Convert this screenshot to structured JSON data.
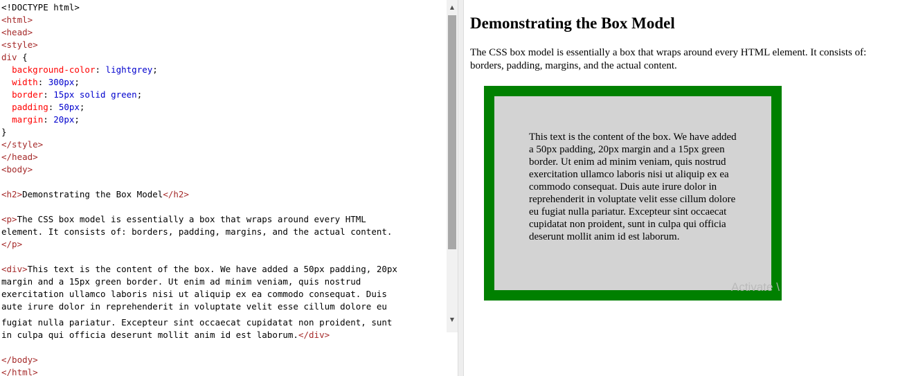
{
  "code_lines": [
    [
      {
        "t": "txt",
        "s": "<!DOCTYPE html>"
      }
    ],
    [
      {
        "t": "tag",
        "s": "<html>"
      }
    ],
    [
      {
        "t": "tag",
        "s": "<head>"
      }
    ],
    [
      {
        "t": "tag",
        "s": "<style>"
      }
    ],
    [
      {
        "t": "sel",
        "s": "div"
      },
      {
        "t": "pun",
        "s": " {"
      }
    ],
    [
      {
        "t": "pun",
        "s": "  "
      },
      {
        "t": "prop",
        "s": "background-color"
      },
      {
        "t": "pun",
        "s": ": "
      },
      {
        "t": "val",
        "s": "lightgrey"
      },
      {
        "t": "pun",
        "s": ";"
      }
    ],
    [
      {
        "t": "pun",
        "s": "  "
      },
      {
        "t": "prop",
        "s": "width"
      },
      {
        "t": "pun",
        "s": ": "
      },
      {
        "t": "val",
        "s": "300px"
      },
      {
        "t": "pun",
        "s": ";"
      }
    ],
    [
      {
        "t": "pun",
        "s": "  "
      },
      {
        "t": "prop",
        "s": "border"
      },
      {
        "t": "pun",
        "s": ": "
      },
      {
        "t": "val",
        "s": "15px solid green"
      },
      {
        "t": "pun",
        "s": ";"
      }
    ],
    [
      {
        "t": "pun",
        "s": "  "
      },
      {
        "t": "prop",
        "s": "padding"
      },
      {
        "t": "pun",
        "s": ": "
      },
      {
        "t": "val",
        "s": "50px"
      },
      {
        "t": "pun",
        "s": ";"
      }
    ],
    [
      {
        "t": "pun",
        "s": "  "
      },
      {
        "t": "prop",
        "s": "margin"
      },
      {
        "t": "pun",
        "s": ": "
      },
      {
        "t": "val",
        "s": "20px"
      },
      {
        "t": "pun",
        "s": ";"
      }
    ],
    [
      {
        "t": "pun",
        "s": "}"
      }
    ],
    [
      {
        "t": "tag",
        "s": "</style>"
      }
    ],
    [
      {
        "t": "tag",
        "s": "</head>"
      }
    ],
    [
      {
        "t": "tag",
        "s": "<body>"
      }
    ],
    [],
    [
      {
        "t": "tag",
        "s": "<h2>"
      },
      {
        "t": "txt",
        "s": "Demonstrating the Box Model"
      },
      {
        "t": "tag",
        "s": "</h2>"
      }
    ],
    [],
    [
      {
        "t": "tag",
        "s": "<p>"
      },
      {
        "t": "txt",
        "s": "The CSS box model is essentially a box that wraps around every HTML"
      }
    ],
    [
      {
        "t": "txt",
        "s": "element. It consists of: borders, padding, margins, and the actual content."
      }
    ],
    [
      {
        "t": "tag",
        "s": "</p>"
      }
    ],
    [],
    [
      {
        "t": "tag",
        "s": "<div>"
      },
      {
        "t": "txt",
        "s": "This text is the content of the box. We have added a 50px padding, 20px"
      }
    ],
    [
      {
        "t": "txt",
        "s": "margin and a 15px green border. Ut enim ad minim veniam, quis nostrud"
      }
    ],
    [
      {
        "t": "txt",
        "s": "exercitation ullamco laboris nisi ut aliquip ex ea commodo consequat. Duis"
      }
    ],
    [
      {
        "t": "txt",
        "s": "aute irure dolor in reprehenderit in voluptate velit esse cillum dolore eu"
      }
    ],
    [
      {
        "t": "txt",
        "s": "fugiat nulla pariatur. Excepteur sint occaecat cupidatat non proident, sunt"
      }
    ],
    [
      {
        "t": "txt",
        "s": "in culpa qui officia deserunt mollit anim id est laborum."
      },
      {
        "t": "tag",
        "s": "</div>"
      }
    ],
    [],
    [
      {
        "t": "tag",
        "s": "</body>"
      }
    ],
    [
      {
        "t": "tag",
        "s": "</html>"
      }
    ]
  ],
  "result": {
    "heading": "Demonstrating the Box Model",
    "paragraph": "The CSS box model is essentially a box that wraps around every HTML element. It consists of: borders, padding, margins, and the actual content.",
    "box_text": "This text is the content of the box. We have added a 50px padding, 20px margin and a 15px green border. Ut enim ad minim veniam, quis nostrud exercitation ullamco laboris nisi ut aliquip ex ea commodo consequat. Duis aute irure dolor in reprehenderit in voluptate velit esse cillum dolore eu fugiat nulla pariatur. Excepteur sint occaecat cupidatat non proident, sunt in culpa qui officia deserunt mollit anim id est laborum.",
    "watermark": "Activate \\"
  },
  "icons": {
    "scroll_up": "scroll-up-arrow-icon",
    "scroll_down": "scroll-down-arrow-icon"
  },
  "colors": {
    "tag": "#a52a2a",
    "property": "#ff0000",
    "value": "#0000cd",
    "box_border": "#008000",
    "box_background": "#d3d3d3"
  }
}
